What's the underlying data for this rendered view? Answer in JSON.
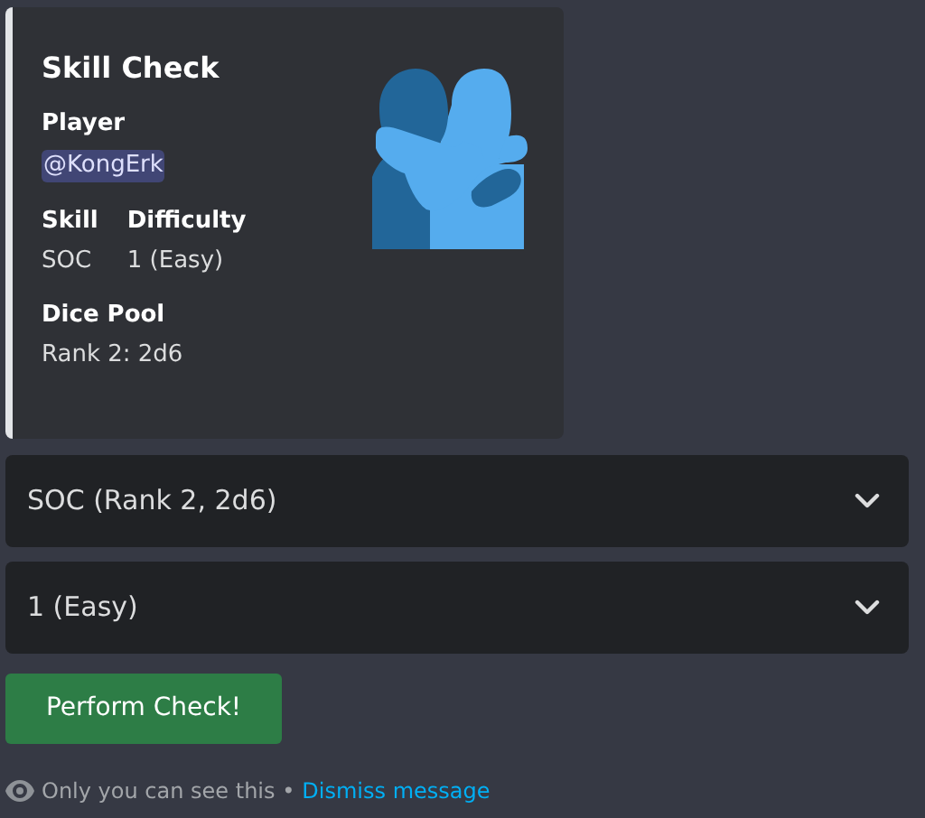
{
  "embed": {
    "title": "Skill Check",
    "player_label": "Player",
    "player_mention": "@KongErk",
    "fields": [
      {
        "name": "Skill",
        "value": "SOC"
      },
      {
        "name": "Difficulty",
        "value": "1 (Easy)"
      }
    ],
    "dice_label": "Dice Pool",
    "dice_value": "Rank 2: 2d6"
  },
  "selects": [
    {
      "value": "SOC (Rank 2, 2d6)"
    },
    {
      "value": "1 (Easy)"
    }
  ],
  "button": "Perform Check!",
  "footer": {
    "note": "Only you can see this •",
    "link": "Dismiss message"
  }
}
